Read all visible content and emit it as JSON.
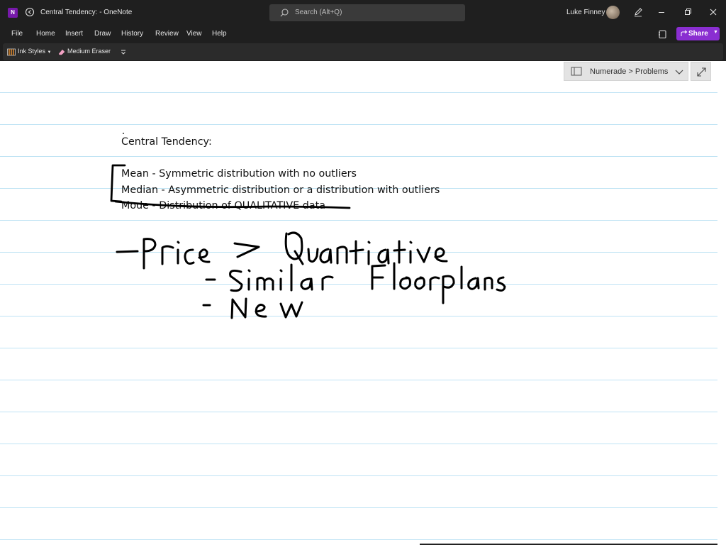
{
  "titlebar": {
    "app_icon_letter": "N",
    "title": "Central Tendency:  - OneNote",
    "search_placeholder": "Search (Alt+Q)",
    "user_name": "Luke Finney"
  },
  "menu": {
    "items": [
      "File",
      "Home",
      "Insert",
      "Draw",
      "History",
      "Review",
      "View",
      "Help"
    ],
    "share_label": "Share"
  },
  "toolbar": {
    "ink_styles_label": "Ink Styles",
    "eraser_label": "Medium Eraser"
  },
  "breadcrumb": {
    "text": "Numerade > Problems"
  },
  "note": {
    "heading": "Central Tendency:",
    "lines": [
      "Mean - Symmetric distribution with no outliers",
      "Median - Asymmetric distribution or a distribution with outliers",
      "Mode - Distribution of QUALITATIVE data"
    ]
  },
  "ink": {
    "handwriting_lines": [
      "-Price → Quantiative",
      "- Similar Floorplans",
      "- New"
    ],
    "color": "#000000"
  },
  "colors": {
    "chrome": "#1f1f1f",
    "accent": "#8a2ed1",
    "rule_line": "#bfe3f4"
  },
  "icons": [
    "onenote-logo-icon",
    "back-icon",
    "search-icon",
    "avatar",
    "pen-icon",
    "minimize-icon",
    "restore-icon",
    "close-icon",
    "notebook-icon",
    "share-icon",
    "ink-styles-icon",
    "eraser-icon",
    "more-icon",
    "section-icon",
    "chevron-down-icon",
    "expand-icon"
  ]
}
